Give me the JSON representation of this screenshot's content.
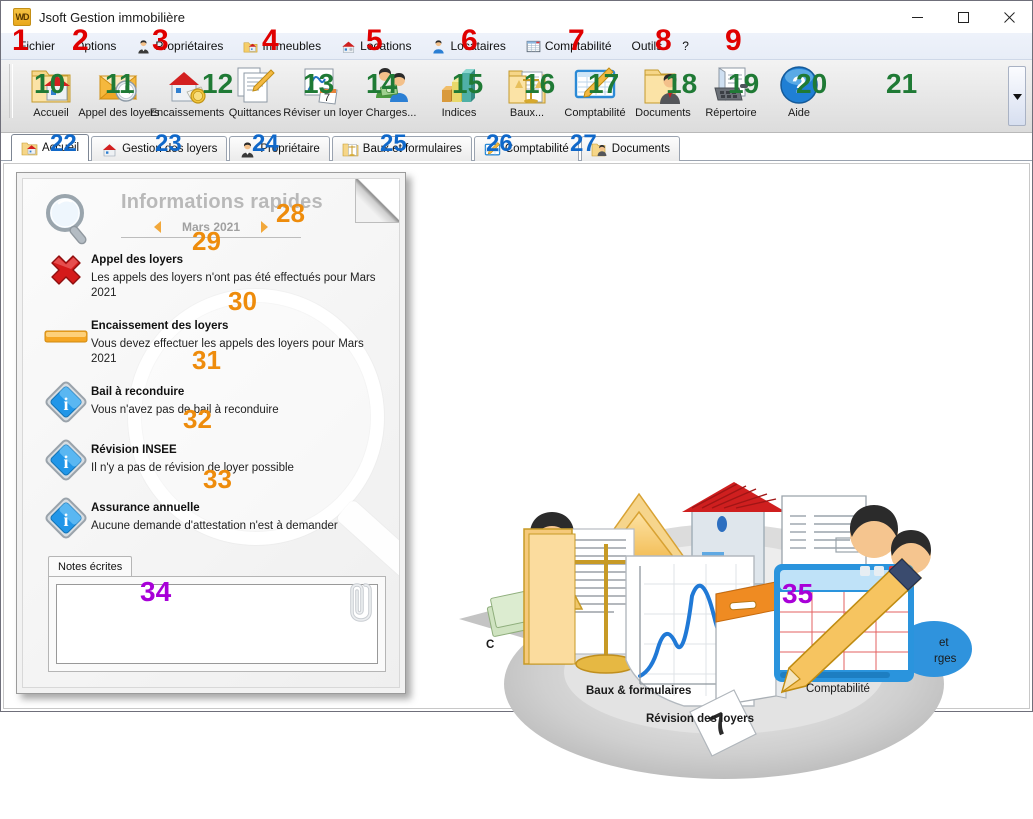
{
  "window": {
    "title": "Jsoft Gestion immobilière",
    "logo_text": "WD",
    "controls": {
      "minimize": "minimize-button",
      "maximize": "maximize-button",
      "close": "close-button"
    }
  },
  "menubar": {
    "items": [
      {
        "label": "Fichier",
        "icon": "none",
        "annotation": "1"
      },
      {
        "label": "Options",
        "icon": "none",
        "annotation": "2"
      },
      {
        "label": "Propriétaires",
        "icon": "person-suit-icon",
        "annotation": "3"
      },
      {
        "label": "Immeubles",
        "icon": "folder-house-icon",
        "annotation": "4"
      },
      {
        "label": "Locations",
        "icon": "house-key-icon",
        "annotation": "5"
      },
      {
        "label": "Locataires",
        "icon": "person-blue-icon",
        "annotation": "6"
      },
      {
        "label": "Comptabilité",
        "icon": "spreadsheet-icon",
        "annotation": "7"
      },
      {
        "label": "Outils",
        "icon": "none",
        "annotation": "8"
      },
      {
        "label": "?",
        "icon": "none",
        "annotation": "9"
      }
    ]
  },
  "toolbar": {
    "items": [
      {
        "label": "Accueil",
        "icon": "folder-house-icon",
        "annotation": "10"
      },
      {
        "label": "Appel des loyers",
        "icon": "envelope-clock-icon",
        "annotation": "11"
      },
      {
        "label": "Encaissements",
        "icon": "house-coin-icon",
        "annotation": "12"
      },
      {
        "label": "Quittances",
        "icon": "documents-pen-icon",
        "annotation": "13"
      },
      {
        "label": "Réviser un loyer",
        "icon": "chart-calendar-icon",
        "annotation": "14"
      },
      {
        "label": "Charges...",
        "icon": "people-money-icon",
        "annotation": "15"
      },
      {
        "label": "Indices",
        "icon": "bar-chart-icon",
        "annotation": "16"
      },
      {
        "label": "Baux...",
        "icon": "folder-scales-icon",
        "annotation": "17"
      },
      {
        "label": "Comptabilité",
        "icon": "spreadsheet-pencil-icon",
        "annotation": "18"
      },
      {
        "label": "Documents",
        "icon": "folder-person-icon",
        "annotation": "19"
      },
      {
        "label": "Répertoire",
        "icon": "phone-book-icon",
        "annotation": "20"
      },
      {
        "label": "Aide",
        "icon": "question-help-icon",
        "annotation": "21"
      }
    ],
    "scroll_icon": "chevron-down-icon"
  },
  "tabs": [
    {
      "label": "Accueil",
      "icon": "folder-house-icon",
      "active": true,
      "annotation": "22"
    },
    {
      "label": "Gestion des loyers",
      "icon": "house-red-icon",
      "active": false,
      "annotation": "23"
    },
    {
      "label": "Propriétaire",
      "icon": "person-suit-icon",
      "active": false,
      "annotation": "24"
    },
    {
      "label": "Baux et formulaires",
      "icon": "folder-scales-icon",
      "active": false,
      "annotation": "25"
    },
    {
      "label": "Comptabilité",
      "icon": "spreadsheet-pencil-icon",
      "active": false,
      "annotation": "26"
    },
    {
      "label": "Documents",
      "icon": "folder-person-icon",
      "active": false,
      "annotation": "27"
    }
  ],
  "info_panel": {
    "title": "Informations rapides",
    "period": "Mars 2021",
    "prev_label": "prev-month-arrow",
    "next_label": "next-month-arrow",
    "period_annotation": "28",
    "items": [
      {
        "title": "Appel des loyers",
        "desc": "Les appels des loyers n'ont pas été effectués pour Mars 2021",
        "status": "error",
        "icon": "red-cross-icon",
        "annotation": "29"
      },
      {
        "title": "Encaissement des loyers",
        "desc": "Vous devez effectuer les appels des loyers pour Mars 2021",
        "status": "warning",
        "icon": "orange-bar-icon",
        "annotation": "30"
      },
      {
        "title": "Bail à reconduire",
        "desc": "Vous n'avez pas de bail à reconduire",
        "status": "info",
        "icon": "info-diamond-icon",
        "annotation": "31"
      },
      {
        "title": "Révision INSEE",
        "desc": "Il n'y a pas de révision de loyer possible",
        "status": "info",
        "icon": "info-diamond-icon",
        "annotation": "32"
      },
      {
        "title": "Assurance annuelle",
        "desc": "Aucune demande d'attestation n'est à demander",
        "status": "info",
        "icon": "info-diamond-icon",
        "annotation": "33"
      }
    ],
    "notes": {
      "tab_label": "Notes écrites",
      "value": "",
      "placeholder": "",
      "annotation": "34",
      "clip_icon": "paperclip-icon"
    }
  },
  "hero": {
    "annotation": "35",
    "captions": [
      {
        "text": "Baux & formulaires"
      },
      {
        "text": "Révision des loyers"
      },
      {
        "text": "Comptabilité"
      }
    ]
  },
  "colors": {
    "accent_orange": "#ee8c0c",
    "error_red": "#cc1111",
    "info_blue": "#1e8fd5",
    "ann_red": "#e00000",
    "ann_green": "#1f7a35",
    "ann_blue": "#1068c9",
    "ann_purple": "#a800d8"
  }
}
